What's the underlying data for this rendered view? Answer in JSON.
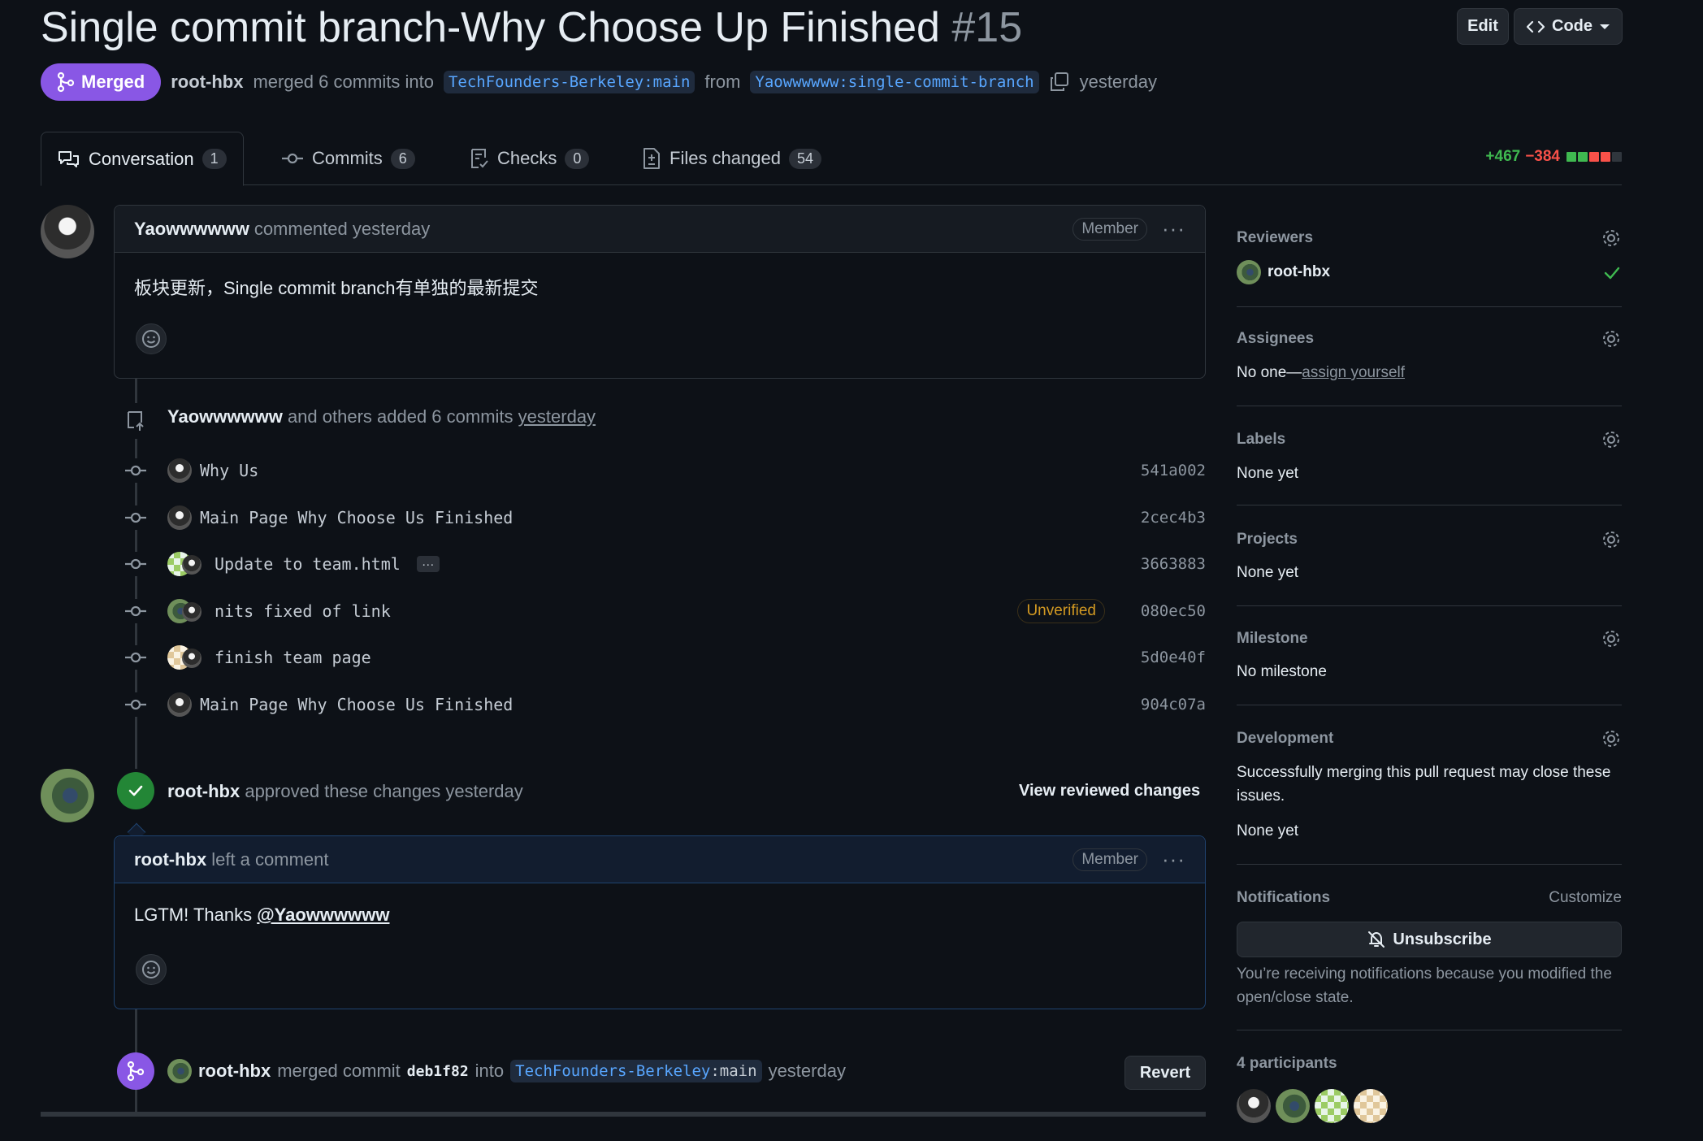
{
  "pr": {
    "title": "Single commit branch-Why Choose Up Finished",
    "number": "#15",
    "state": "Merged",
    "author": "root-hbx",
    "merge_text": "merged 6 commits into",
    "base_branch": "TechFounders-Berkeley:main",
    "from_text": "from",
    "head_branch": "Yaowwwwww:single-commit-branch",
    "time": "yesterday"
  },
  "header_buttons": {
    "edit": "Edit",
    "code": "Code"
  },
  "tabs": [
    {
      "label": "Conversation",
      "count": "1"
    },
    {
      "label": "Commits",
      "count": "6"
    },
    {
      "label": "Checks",
      "count": "0"
    },
    {
      "label": "Files changed",
      "count": "54"
    }
  ],
  "diffstat": {
    "additions": "+467",
    "deletions": "−384"
  },
  "comment1": {
    "author": "Yaowwwwww",
    "action": "commented yesterday",
    "badge": "Member",
    "body": "板块更新，Single commit branch有单独的最新提交"
  },
  "commits_event": {
    "author": "Yaowwwwww",
    "text": "and others added 6 commits",
    "time": "yesterday"
  },
  "commits": [
    {
      "message": "Why Us",
      "sha": "541a002"
    },
    {
      "message": "Main Page Why Choose Us Finished",
      "sha": "2cec4b3"
    },
    {
      "message": "Update to team.html",
      "sha": "3663883",
      "ellipsis": "…"
    },
    {
      "message": "nits fixed of link",
      "sha": "080ec50",
      "badge": "Unverified"
    },
    {
      "message": "finish team page",
      "sha": "5d0e40f"
    },
    {
      "message": "Main Page Why Choose Us Finished",
      "sha": "904c07a"
    }
  ],
  "review_event": {
    "author": "root-hbx",
    "text": "approved these changes yesterday",
    "button": "View reviewed changes"
  },
  "comment2": {
    "author": "root-hbx",
    "action": "left a comment",
    "badge": "Member",
    "body_prefix": "LGTM! Thanks",
    "mention": "@Yaowwwwww"
  },
  "merge_event": {
    "author": "root-hbx",
    "text1": "merged commit",
    "sha": "deb1f82",
    "text2": "into",
    "branch_owner": "TechFounders-Berkeley",
    "branch_name": ":main",
    "time": "yesterday",
    "button": "Revert"
  },
  "sidebar": {
    "reviewers": {
      "title": "Reviewers",
      "name": "root-hbx"
    },
    "assignees": {
      "title": "Assignees",
      "text": "No one—",
      "link": "assign yourself"
    },
    "labels": {
      "title": "Labels",
      "text": "None yet"
    },
    "projects": {
      "title": "Projects",
      "text": "None yet"
    },
    "milestone": {
      "title": "Milestone",
      "text": "No milestone"
    },
    "development": {
      "title": "Development",
      "text": "Successfully merging this pull request may close these issues.",
      "none": "None yet"
    },
    "notifications": {
      "title": "Notifications",
      "customize": "Customize",
      "button": "Unsubscribe",
      "note": "You’re receiving notifications because you modified the open/close state."
    },
    "participants": {
      "title": "4 participants"
    }
  },
  "colors": {
    "merged": "#8957e5",
    "approved": "#238636",
    "link": "#58a6ff",
    "add": "#3fb950",
    "del": "#f85149",
    "warning": "#d29922"
  }
}
